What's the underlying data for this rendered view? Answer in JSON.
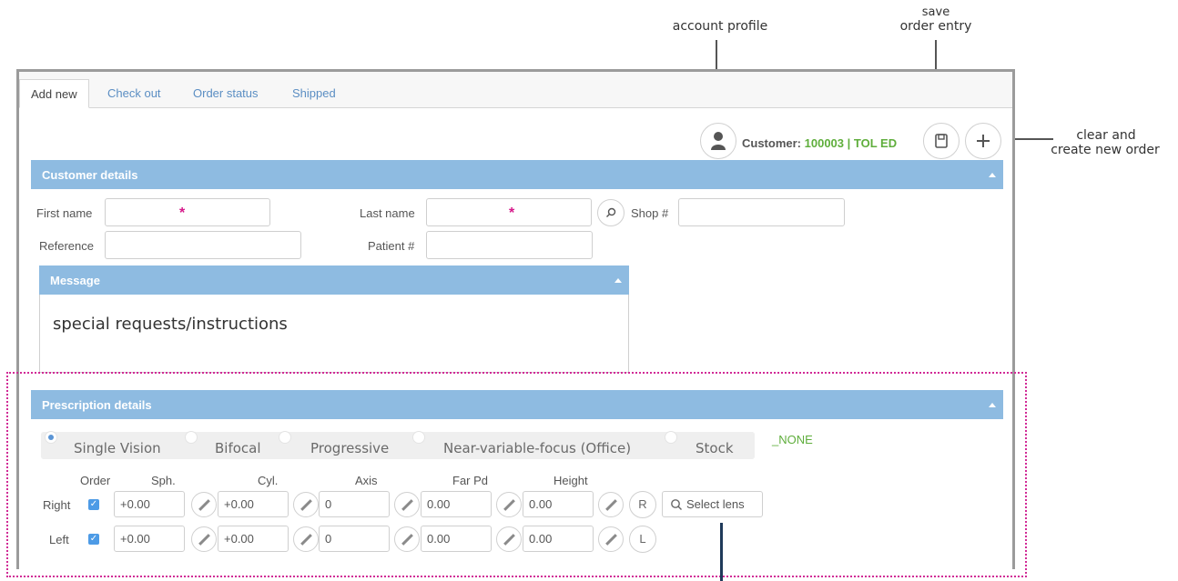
{
  "annotations": {
    "account_profile": "account profile",
    "save_line1": "save",
    "save_line2": "order entry",
    "clear_line1": "clear and",
    "clear_line2": "create new order"
  },
  "tabs": [
    "Add new",
    "Check out",
    "Order status",
    "Shipped"
  ],
  "customer": {
    "label": "Customer:",
    "value": "100003 | TOL ED"
  },
  "customer_details": {
    "title": "Customer details",
    "first_name_label": "First name",
    "last_name_label": "Last name",
    "shop_label": "Shop #",
    "reference_label": "Reference",
    "patient_label": "Patient #",
    "required_mark": "*"
  },
  "message": {
    "title": "Message",
    "text": "special requests/instructions"
  },
  "prescription": {
    "title": "Prescription details",
    "options": [
      "Single Vision",
      "Bifocal",
      "Progressive",
      "Near-variable-focus (Office)",
      "Stock"
    ],
    "selected_option": "Single Vision",
    "none_label": "_NONE",
    "columns": [
      "Order",
      "Sph.",
      "Cyl.",
      "Axis",
      "Far Pd",
      "Height"
    ],
    "rows": [
      {
        "label": "Right",
        "ordered": true,
        "sph": "+0.00",
        "cyl": "+0.00",
        "axis": "0",
        "far_pd": "0.00",
        "height": "0.00",
        "eye": "R"
      },
      {
        "label": "Left",
        "ordered": true,
        "sph": "+0.00",
        "cyl": "+0.00",
        "axis": "0",
        "far_pd": "0.00",
        "height": "0.00",
        "eye": "L"
      }
    ],
    "select_lens_label": "Select lens"
  },
  "colors": {
    "header": "#8ebbe1",
    "link": "#5b8ec3",
    "customer_id": "#5fae3c",
    "required": "#d6198a",
    "highlight_border": "#d12a96"
  }
}
